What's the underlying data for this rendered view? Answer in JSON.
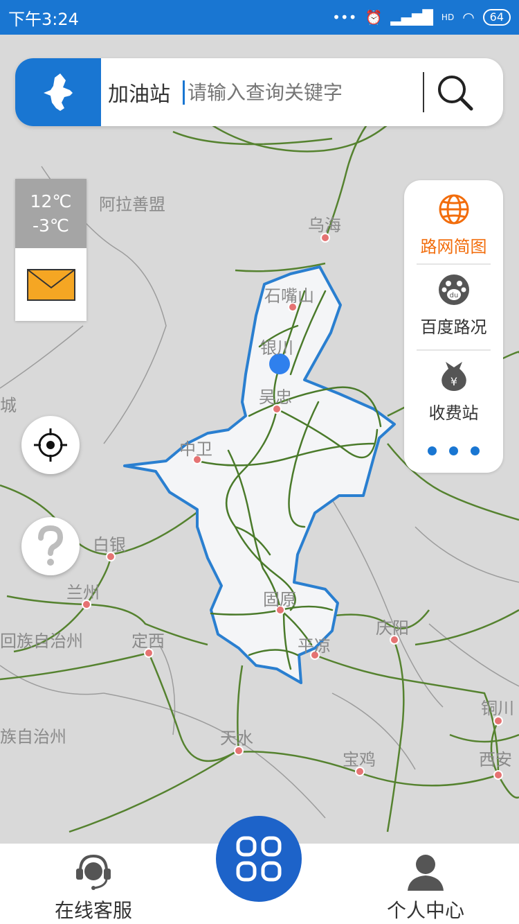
{
  "status_bar": {
    "time": "下午3:24",
    "signal_label": "HD",
    "battery": "64"
  },
  "search": {
    "category": "加油站",
    "placeholder": "请输入查询关键字"
  },
  "weather": {
    "high": "12℃",
    "low": "-3℃"
  },
  "map": {
    "labels": {
      "alashan": "阿拉善盟",
      "wuhai": "乌海",
      "shizuishan": "石嘴山",
      "yinchuan": "银川",
      "wuzhong": "吴忠",
      "zhongwei": "中卫",
      "baiyin": "白银",
      "lanzhou": "兰州",
      "linxia": "回族自治州",
      "dingxi": "定西",
      "guyuan": "固原",
      "pingliang": "平凉",
      "qingyang": "庆阳",
      "tianshui": "天水",
      "gannan": "族自治州",
      "baoji": "宝鸡",
      "tongchuan": "铜川",
      "xian": "西安",
      "edge": "城"
    }
  },
  "right_panel": {
    "items": [
      {
        "label": "路网简图",
        "icon": "globe-icon",
        "color": "#f26d0c"
      },
      {
        "label": "百度路况",
        "icon": "baidu-paw-icon"
      },
      {
        "label": "收费站",
        "icon": "money-bag-icon"
      }
    ]
  },
  "bottom_nav": {
    "service": "在线客服",
    "profile": "个人中心"
  },
  "colors": {
    "primary": "#1976d2",
    "accent": "#f26d0c",
    "region_fill": "#f4f5f7",
    "region_border": "#2a7fd0",
    "road": "#4a7a2a",
    "location_dot": "#2f80ed"
  }
}
